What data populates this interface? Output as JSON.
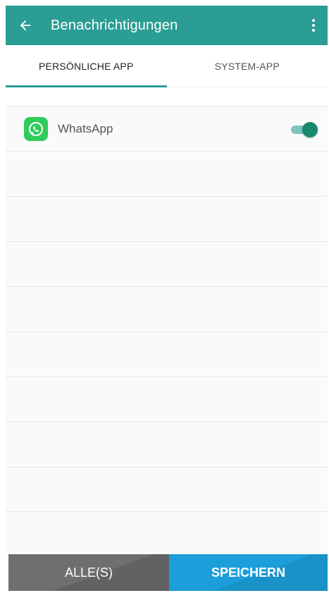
{
  "app_bar": {
    "title": "Benachrichtigungen",
    "back_icon": "arrow-back-icon",
    "more_icon": "more-vert-icon",
    "color": "#2a9d94"
  },
  "tabs": [
    {
      "label": "PERSÖNLICHE APP",
      "active": true
    },
    {
      "label": "SYSTEM-APP",
      "active": false
    }
  ],
  "apps": [
    {
      "name": "WhatsApp",
      "icon": "whatsapp-icon",
      "enabled": true
    }
  ],
  "footer": {
    "all_label": "ALLE(S)",
    "save_label": "SPEICHERN",
    "save_color": "#1b9ed9",
    "all_color": "#6f6f6f"
  }
}
